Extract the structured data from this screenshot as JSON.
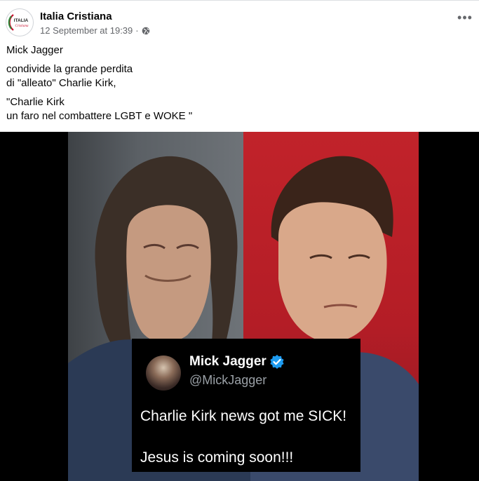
{
  "post": {
    "page_name": "Italia Cristiana",
    "timestamp": "12 September at 19:39",
    "separator": "·",
    "privacy_icon": "globe-icon",
    "more_icon": "more-options-icon",
    "more_glyph": "•••",
    "avatar_logo_text_top": "ITALIA",
    "avatar_logo_text_bottom": "Cristiana",
    "text_lines": [
      "Mick Jagger",
      "condivide la grande perdita",
      "di \"alleato\" Charlie Kirk,",
      "\"Charlie Kirk",
      "un faro nel combattere LGBT e WOKE \""
    ]
  },
  "image": {
    "tweet": {
      "name": "Mick Jagger",
      "verified_icon": "verified-badge-icon",
      "handle": "@MickJagger",
      "line1": "Charlie Kirk news got me SICK!",
      "line2": "Jesus is coming soon!!!"
    }
  },
  "colors": {
    "text_primary": "#050505",
    "text_secondary": "#65676b",
    "verified_blue": "#1d9bf0",
    "logo_red": "#c8102e",
    "logo_green": "#2e8b3c"
  }
}
